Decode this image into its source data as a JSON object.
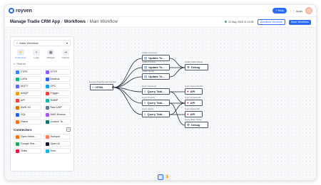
{
  "brand": {
    "name": "royven"
  },
  "top": {
    "help": "Help",
    "apps": "Apps"
  },
  "breadcrumb": {
    "items": [
      "Manage Tradie CRM App",
      "Workflows",
      "Main Workflow"
    ],
    "sep": "/"
  },
  "status": {
    "timestamp": "23 May 2025 11:19:35"
  },
  "actions": {
    "versions": "Workflow Versions",
    "save": "Save Workflow"
  },
  "panel": {
    "workflow": "Main Workflow",
    "categories": [
      {
        "label": "Connectors",
        "icon": "plug-icon"
      },
      {
        "label": "Logic",
        "icon": "logic-icon"
      },
      {
        "label": "Widgets",
        "icon": "widgets-icon"
      },
      {
        "label": "Outputs",
        "icon": "outputs-icon"
      }
    ],
    "search": "Search",
    "nodes": [
      {
        "label": "FTPS",
        "color": "#3b82f6"
      },
      {
        "label": "HTTP",
        "color": "#8b5cf6"
      },
      {
        "label": "LoRa",
        "color": "#10b981"
      },
      {
        "label": "Modbus",
        "color": "#2563eb"
      },
      {
        "label": "MQTT",
        "color": "#6366f1"
      },
      {
        "label": "OPC",
        "color": "#0ea5e9"
      },
      {
        "label": "AMQP",
        "color": "#f59e0b"
      },
      {
        "label": "Trigger",
        "color": "#ef4444"
      },
      {
        "label": "API",
        "color": "#ef4444"
      },
      {
        "label": "SNMP",
        "color": "#14b8a6"
      },
      {
        "label": "AWS S3",
        "color": "#d97706"
      },
      {
        "label": "Raw UDP",
        "color": "#64748b"
      },
      {
        "label": "SQL",
        "color": "#2563eb"
      },
      {
        "label": "AWS Kinesis",
        "color": "#a855f7"
      },
      {
        "label": "Flame",
        "color": "#f97316"
      },
      {
        "label": "Custom To...",
        "color": "#0f766e"
      }
    ],
    "connectors_title": "Connectors",
    "connectors": [
      {
        "label": "Open Weat...",
        "color": "#f97316"
      },
      {
        "label": "Hubspot",
        "color": "#ff7a59"
      },
      {
        "label": "Google She...",
        "color": "#22a565"
      },
      {
        "label": "Open AI",
        "color": "#111827"
      },
      {
        "label": "Twilio",
        "color": "#e11d48"
      },
      {
        "label": "Xero",
        "color": "#13b5ea"
      }
    ]
  },
  "flow": {
    "html": {
      "label": "HTML",
      "caption": "Get Apps Data Box with Services"
    },
    "updates": [
      {
        "label": "Update To...",
        "caption": "Update Customers"
      },
      {
        "label": "Update To...",
        "caption": "Update Products"
      },
      {
        "label": "Update To...",
        "caption": "Update Quotes"
      }
    ],
    "debug_top": {
      "label": "Debug",
      "caption": "Update Tables Debug"
    },
    "queries": [
      {
        "label": "Query Tabl...",
        "caption": "Query Customers"
      },
      {
        "label": "Query Tabl...",
        "caption": "Query Products"
      },
      {
        "label": "Query Tabl...",
        "caption": "Query Quotes"
      }
    ],
    "apis": [
      {
        "label": "API",
        "caption": "Query Customers API"
      },
      {
        "label": "API",
        "caption": "Query Products API"
      },
      {
        "label": "API",
        "caption": "Query Quotes API"
      }
    ],
    "debug_bottom": {
      "label": "Debug",
      "caption": "Query Tables Debug"
    }
  },
  "tools": [
    {
      "icon": "select-icon"
    },
    {
      "icon": "hand-icon"
    }
  ]
}
